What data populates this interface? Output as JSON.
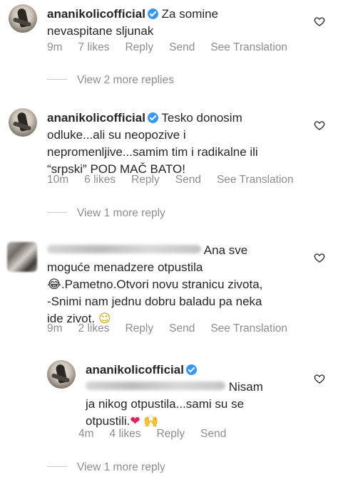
{
  "comments": [
    {
      "username": "ananikolicofficial",
      "text_line1": "Za somine",
      "text_line2": "nevaspitane sljunak",
      "time": "9m",
      "likes": "7 likes",
      "reply": "Reply",
      "send": "Send",
      "translate": "See Translation",
      "more_replies": "View 2 more replies"
    },
    {
      "username": "ananikolicofficial",
      "text_line1": "Tesko donosim",
      "text_line2": "odluke...ali su neopozive i",
      "text_line3": "nepromenljive...samim tim i radikalne ili",
      "text_line4": "“srpski” POD MAČ BATO!",
      "time": "10m",
      "likes": "6 likes",
      "reply": "Reply",
      "send": "Send",
      "translate": "See Translation",
      "more_replies": "View 1 more reply"
    },
    {
      "text_line1": "Ana sve",
      "text_line2": "moguće menadzere  otpustila",
      "text_line3": ".Pametno.Otvori novu stranicu zivota,",
      "text_line4": "-Snimi nam jednu dobru baladu pa neka",
      "text_line5": "ide zivot.",
      "emoji_laugh": "😂",
      "emoji_smile": "☺",
      "time": "9m",
      "likes": "2 likes",
      "reply": "Reply",
      "send": "Send",
      "translate": "See Translation"
    },
    {
      "username": "ananikolicofficial",
      "text_line1": "Nisam",
      "text_line2": "ja nikog otpustila...sami su se",
      "text_line3": "otpustili.",
      "emoji_heart": "❤",
      "emoji_hands": "🙌",
      "time": "4m",
      "likes": "4 likes",
      "reply": "Reply",
      "send": "Send",
      "more_replies": "View 1 more reply"
    }
  ],
  "colors": {
    "text": "#262626",
    "meta": "#8e8e8e",
    "verified": "#3897f0",
    "heart_emoji": "#e0245e"
  }
}
